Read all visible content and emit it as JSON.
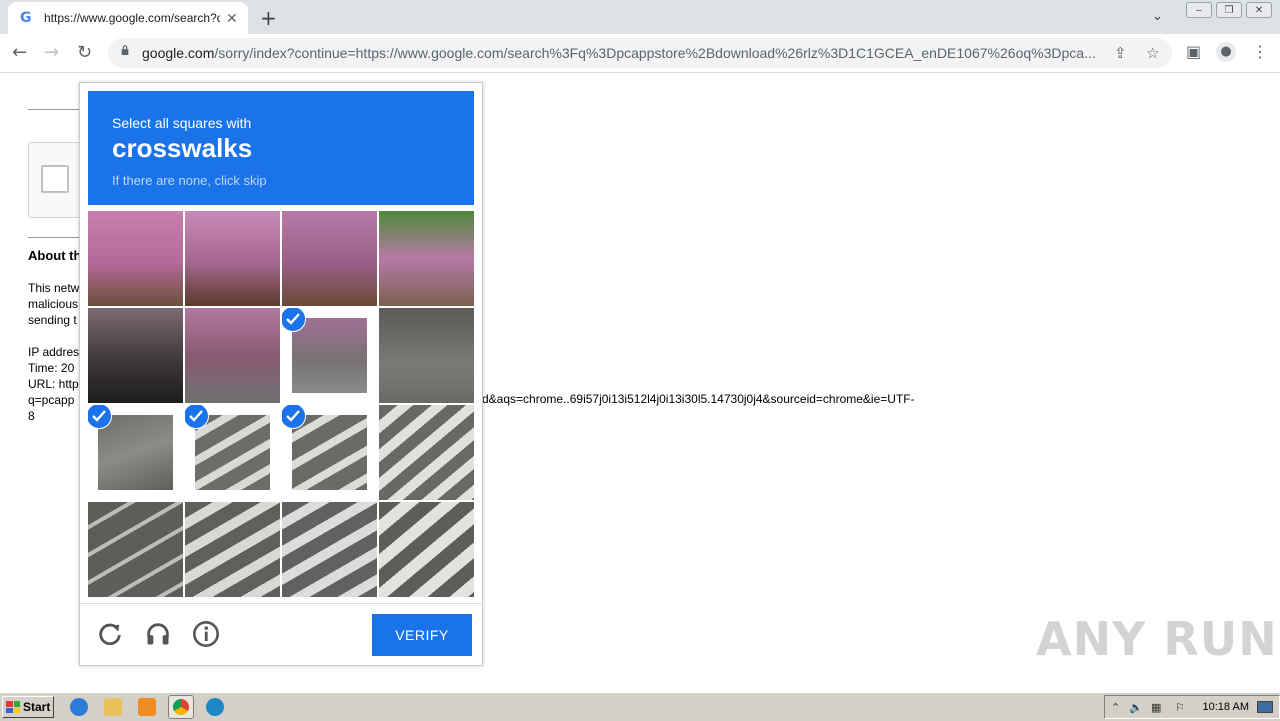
{
  "browser": {
    "tab_title": "https://www.google.com/search?q=",
    "tab_favicon": "G",
    "url_host": "google.com",
    "url_path": "/sorry/index?continue=https://www.google.com/search%3Fq%3Dpcappstore%2Bdownload%26rlz%3D1C1GCEA_enDE1067%26oq%3Dpca..."
  },
  "page": {
    "about_heading": "About th",
    "para1": [
      "This netw",
      "malicious",
      "sending t"
    ],
    "para2": [
      "IP addres",
      "Time: 20",
      "URL: http",
      "q=pcapp",
      "8"
    ],
    "url_tail": "d&aqs=chrome..69i57j0i13i512l4j0i13i30l5.14730j0j4&sourceid=chrome&ie=UTF-"
  },
  "captcha": {
    "line1": "Select all squares with",
    "target": "crosswalks",
    "line3": "If there are none, click skip",
    "verify_label": "VERIFY",
    "selected_cells": [
      6,
      8,
      9,
      10
    ],
    "accent": "#1a73e8"
  },
  "watermark": "ANY RUN",
  "taskbar": {
    "start_label": "Start",
    "time": "10:18 AM"
  }
}
